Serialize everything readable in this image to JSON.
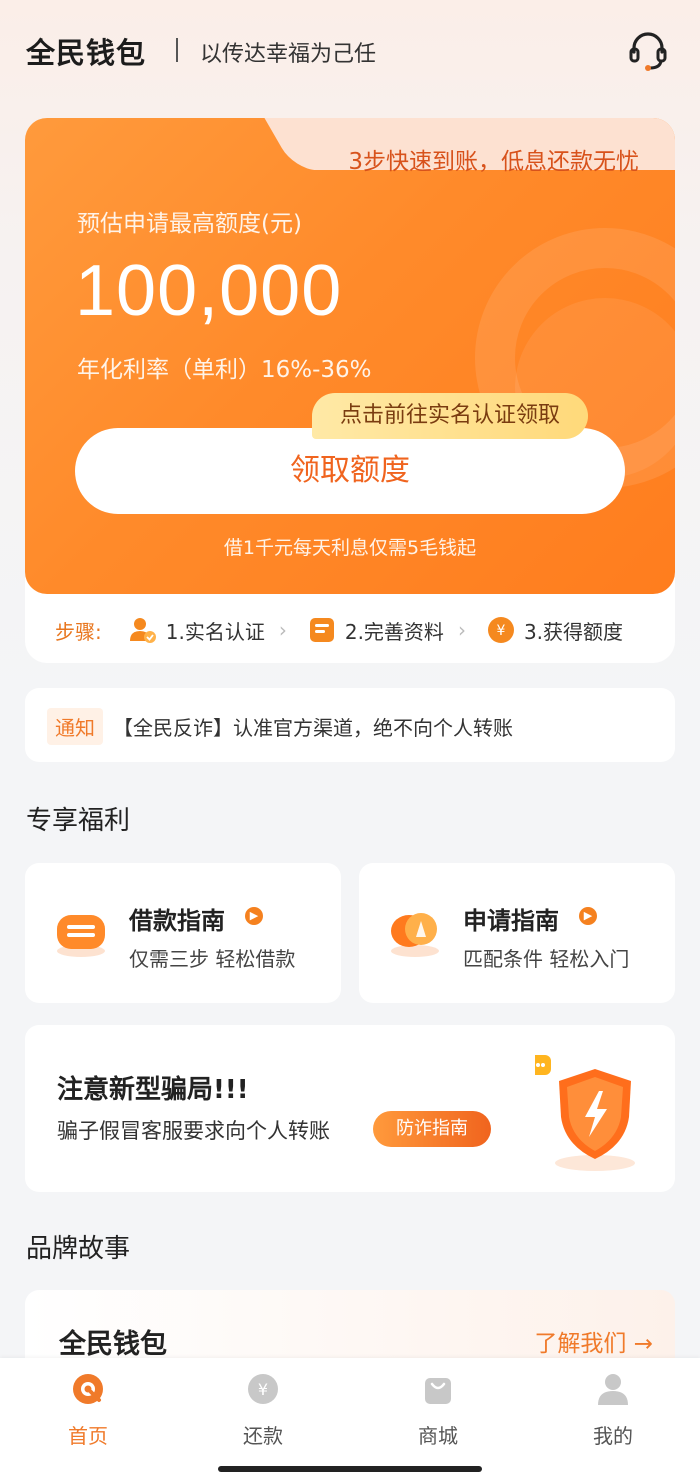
{
  "header": {
    "app_title": "全民钱包",
    "slogan": "以传达幸福为己任",
    "icon": "customer-service-headset-icon"
  },
  "hero": {
    "tab_text": "3步快速到账，低息还款无忧",
    "quota_label": "预估申请最高额度(元)",
    "quota_value": "100,000",
    "rate_label": "年化利率（单利）16%-36%",
    "claim_tip": "点击前往实名认证领取",
    "claim_button": "领取额度",
    "subtitle": "借1千元每天利息仅需5毛钱起",
    "accent_color": "#ff8a2a"
  },
  "steps": {
    "label": "步骤:",
    "items": [
      {
        "label": "1.实名认证",
        "icon": "user-verify-icon"
      },
      {
        "label": "2.完善资料",
        "icon": "document-icon"
      },
      {
        "label": "3.获得额度",
        "icon": "yuan-coin-icon"
      }
    ]
  },
  "notice": {
    "tag": "通知",
    "text": "【全民反诈】认准官方渠道，绝不向个人转账"
  },
  "benefits": {
    "title": "专享福利",
    "cards": [
      {
        "title": "借款指南",
        "subtitle": "仅需三步 轻松借款",
        "icon": "loan-guide-icon"
      },
      {
        "title": "申请指南",
        "subtitle": "匹配条件 轻松入门",
        "icon": "compass-icon"
      }
    ]
  },
  "fraud": {
    "title": "注意新型骗局!!!",
    "subtitle": "骗子假冒客服要求向个人转账",
    "button": "防诈指南",
    "icon": "shield-lightning-icon"
  },
  "brand": {
    "title": "品牌故事",
    "name": "全民钱包",
    "link": "了解我们 →"
  },
  "tabbar": {
    "items": [
      {
        "label": "首页",
        "icon": "home-icon",
        "active": true
      },
      {
        "label": "还款",
        "icon": "repay-yuan-icon",
        "active": false
      },
      {
        "label": "商城",
        "icon": "shopping-bag-icon",
        "active": false
      },
      {
        "label": "我的",
        "icon": "profile-icon",
        "active": false
      }
    ]
  }
}
